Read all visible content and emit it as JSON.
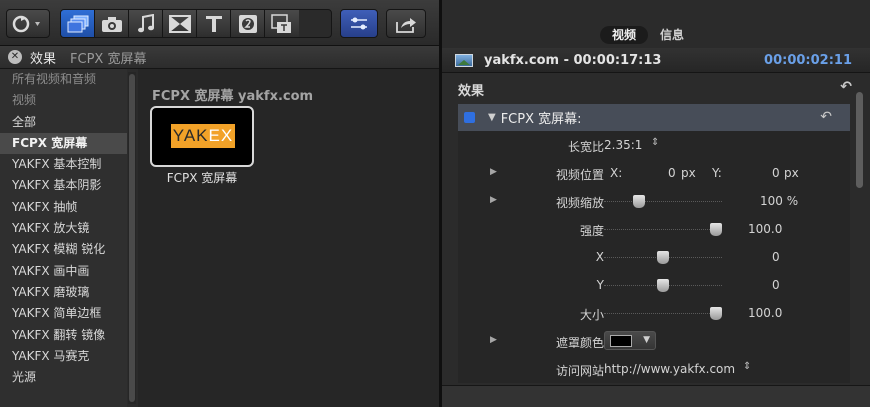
{
  "toolbar": {
    "import_icon": "refresh-circle-icon",
    "media_buttons": [
      {
        "icon": "video-clips-icon",
        "selected": true
      },
      {
        "icon": "camera-icon",
        "selected": false
      },
      {
        "icon": "music-note-icon",
        "selected": false
      },
      {
        "icon": "transitions-icon",
        "selected": false
      },
      {
        "icon": "titles-icon",
        "selected": false
      },
      {
        "icon": "generators-icon",
        "selected": false
      },
      {
        "icon": "themes-icon",
        "selected": false
      }
    ],
    "inspector_icon": "inspector-sliders-icon",
    "share_icon": "share-icon"
  },
  "effects_panel": {
    "header_title": "效果",
    "header_subtitle": "FCPX 宽屏幕",
    "categories": [
      {
        "label": "所有视频和音频",
        "type": "head"
      },
      {
        "label": "视频",
        "type": "head"
      },
      {
        "label": "全部",
        "type": "item"
      },
      {
        "label": "FCPX 宽屏幕",
        "type": "selected"
      },
      {
        "label": "YAKFX 基本控制",
        "type": "item"
      },
      {
        "label": "YAKFX 基本阴影",
        "type": "item"
      },
      {
        "label": "YAKFX 抽帧",
        "type": "item"
      },
      {
        "label": "YAKFX 放大镜",
        "type": "item"
      },
      {
        "label": "YAKFX 模糊 锐化",
        "type": "item"
      },
      {
        "label": "YAKFX 画中画",
        "type": "item"
      },
      {
        "label": "YAKFX 磨玻璃",
        "type": "item"
      },
      {
        "label": "YAKFX 简单边框",
        "type": "item"
      },
      {
        "label": "YAKFX 翻转 镜像",
        "type": "item"
      },
      {
        "label": "YAKFX 马赛克",
        "type": "item"
      },
      {
        "label": "光源",
        "type": "item"
      }
    ],
    "browser_title": "FCPX 宽屏幕 yakfx.com",
    "effect_thumb": {
      "logo_left": "YAK",
      "logo_right": "EX",
      "label": "FCPX 宽屏幕"
    }
  },
  "inspector": {
    "tabs": [
      {
        "label": "视频",
        "selected": true
      },
      {
        "label": "信息",
        "selected": false
      }
    ],
    "clip_title": "yakfx.com - 00:00:17:13",
    "clip_duration": "00:00:02:11",
    "effects_label": "效果",
    "effect_name": "FCPX 宽屏幕:",
    "params": {
      "aspect": {
        "label": "长宽比",
        "value": "2.35:1"
      },
      "position": {
        "label": "视频位置",
        "x_label": "X:",
        "x_value": "0",
        "x_unit": "px",
        "y_label": "Y:",
        "y_value": "0",
        "y_unit": "px"
      },
      "scale": {
        "label": "视频缩放",
        "value": "100 %",
        "level": 0.27
      },
      "strength": {
        "label": "强度",
        "value": "100.0",
        "level": 1.0
      },
      "x": {
        "label": "X",
        "value": "0",
        "level": 0.5
      },
      "y": {
        "label": "Y",
        "value": "0",
        "level": 0.5
      },
      "size": {
        "label": "大小",
        "value": "100.0",
        "level": 1.0
      },
      "mask_color": {
        "label": "遮罩颜色",
        "color": "#000000"
      },
      "website": {
        "label": "访问网站",
        "value": "http://www.yakfx.com"
      }
    }
  }
}
